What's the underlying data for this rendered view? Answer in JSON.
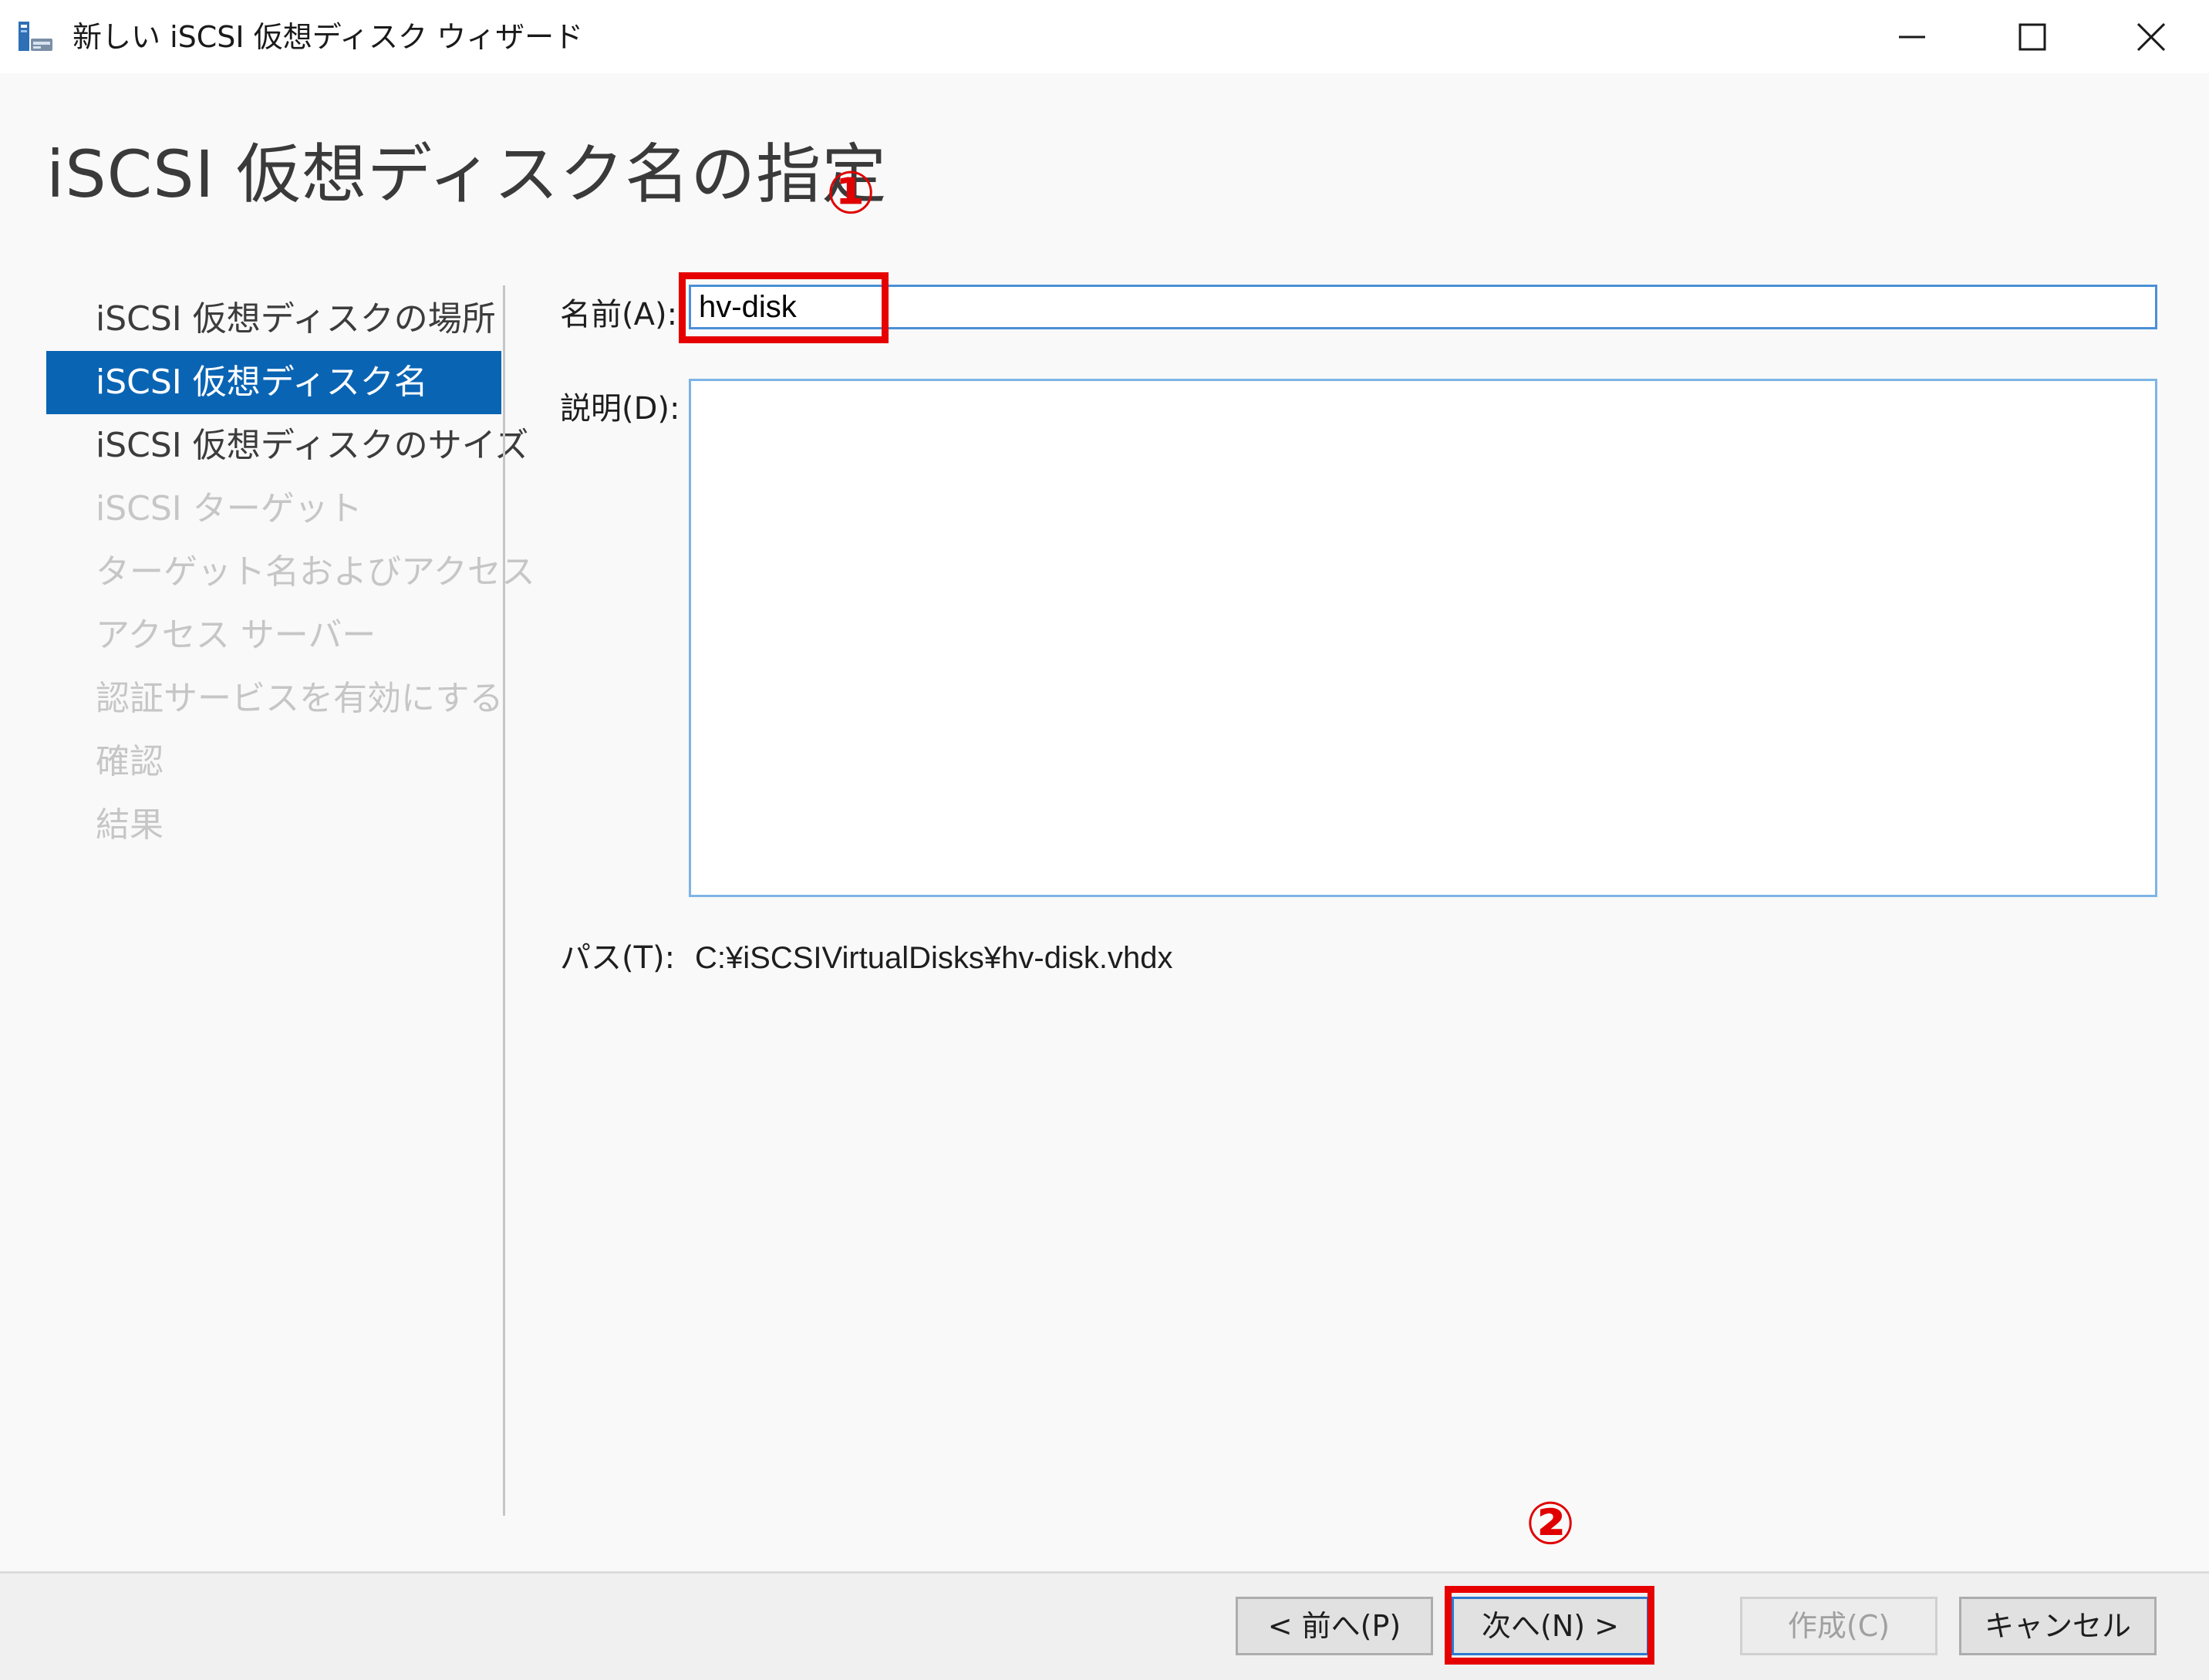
{
  "window": {
    "title": "新しい iSCSI 仮想ディスク ウィザード",
    "icon": "wizard-disk-icon",
    "controls": [
      "minimize-icon",
      "maximize-icon",
      "close-icon"
    ]
  },
  "page": {
    "heading": "iSCSI 仮想ディスク名の指定"
  },
  "annotations": {
    "marker_1": "①",
    "marker_2": "②",
    "highlight_color": "#e60000"
  },
  "nav": {
    "items": [
      {
        "label": "iSCSI 仮想ディスクの場所",
        "state": "normal"
      },
      {
        "label": "iSCSI 仮想ディスク名",
        "state": "active"
      },
      {
        "label": "iSCSI 仮想ディスクのサイズ",
        "state": "normal"
      },
      {
        "label": "iSCSI ターゲット",
        "state": "disabled"
      },
      {
        "label": "ターゲット名およびアクセス",
        "state": "disabled"
      },
      {
        "label": "アクセス サーバー",
        "state": "disabled"
      },
      {
        "label": "認証サービスを有効にする",
        "state": "disabled"
      },
      {
        "label": "確認",
        "state": "disabled"
      },
      {
        "label": "結果",
        "state": "disabled"
      }
    ],
    "active_color": "#0a64b4"
  },
  "form": {
    "name_label": "名前(A):",
    "name_value": "hv-disk",
    "description_label": "説明(D):",
    "description_value": "",
    "path_label": "パス(T):",
    "path_value": "C:¥iSCSIVirtualDisks¥hv-disk.vhdx"
  },
  "footer": {
    "back_label": "< 前へ(P)",
    "next_label": "次へ(N) >",
    "create_label": "作成(C)",
    "cancel_label": "キャンセル",
    "create_enabled": false
  }
}
